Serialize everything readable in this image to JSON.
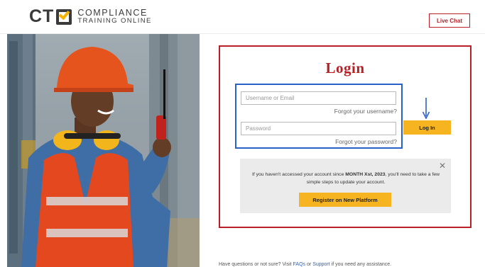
{
  "header": {
    "logo_mark": "CT",
    "logo_line1": "COMPLIANCE",
    "logo_line2": "TRAINING ONLINE",
    "live_chat_label": "Live Chat"
  },
  "login": {
    "title": "Login",
    "username_placeholder": "Username or Email",
    "forgot_username": "Forgot your username?",
    "password_placeholder": "Password",
    "forgot_password": "Forgot your password?",
    "login_button": "Log In"
  },
  "notice": {
    "text_before": "If you haven't accessed your account since ",
    "text_bold": "MONTH Xst, 2023",
    "text_after": ", you'll need to take a few simple steps to update your account.",
    "close_glyph": "✕",
    "register_button": "Register on New Platform"
  },
  "footer": {
    "text_before": "Have questions or not sure? Visit ",
    "link1": "FAQs",
    "text_mid": " or ",
    "link2": "Support",
    "text_after": " if you need any assistance."
  },
  "colors": {
    "brand_red": "#b72026",
    "accent_yellow": "#f6b520",
    "highlight_blue": "#2a62c9"
  },
  "icons": {
    "arrow": "arrow-down-icon",
    "close": "close-icon"
  }
}
